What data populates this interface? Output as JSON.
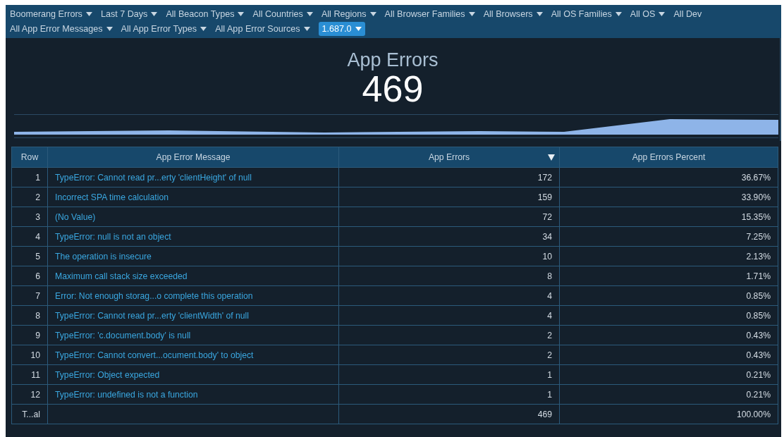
{
  "filter_lines": [
    [
      {
        "label": "Boomerang Errors",
        "selected": false
      },
      {
        "label": "Last 7 Days",
        "selected": false
      },
      {
        "label": "All Beacon Types",
        "selected": false
      },
      {
        "label": "All Countries",
        "selected": false
      },
      {
        "label": "All Regions",
        "selected": false
      },
      {
        "label": "All Browser Families",
        "selected": false
      },
      {
        "label": "All Browsers",
        "selected": false
      },
      {
        "label": "All OS Families",
        "selected": false
      },
      {
        "label": "All OS",
        "selected": false
      },
      {
        "label": "All Dev",
        "selected": false
      }
    ],
    [
      {
        "label": "All App Error Messages",
        "selected": false
      },
      {
        "label": "All App Error Types",
        "selected": false
      },
      {
        "label": "All App Error Sources",
        "selected": false
      },
      {
        "label": "1.687.0",
        "selected": true
      }
    ]
  ],
  "kpi": {
    "title": "App Errors",
    "value": "469"
  },
  "table": {
    "columns": [
      {
        "label": "Row",
        "sorted": false
      },
      {
        "label": "App Error Message",
        "sorted": false
      },
      {
        "label": "App Errors",
        "sorted": true
      },
      {
        "label": "App Errors Percent",
        "sorted": false
      }
    ],
    "rows": [
      {
        "kind": "data",
        "cells": [
          "1",
          "TypeError: Cannot read pr...erty 'clientHeight' of null",
          "172",
          "36.67%"
        ]
      },
      {
        "kind": "data",
        "cells": [
          "2",
          "Incorrect SPA time calculation",
          "159",
          "33.90%"
        ]
      },
      {
        "kind": "data",
        "cells": [
          "3",
          "(No Value)",
          "72",
          "15.35%"
        ]
      },
      {
        "kind": "data",
        "cells": [
          "4",
          "TypeError: null is not an object",
          "34",
          "7.25%"
        ]
      },
      {
        "kind": "data",
        "cells": [
          "5",
          "The operation is insecure",
          "10",
          "2.13%"
        ]
      },
      {
        "kind": "data",
        "cells": [
          "6",
          "Maximum call stack size exceeded",
          "8",
          "1.71%"
        ]
      },
      {
        "kind": "data",
        "cells": [
          "7",
          "Error: Not enough storag...o complete this operation",
          "4",
          "0.85%"
        ]
      },
      {
        "kind": "data",
        "cells": [
          "8",
          "TypeError: Cannot read pr...erty 'clientWidth' of null",
          "4",
          "0.85%"
        ]
      },
      {
        "kind": "data",
        "cells": [
          "9",
          "TypeError: 'c.document.body' is null",
          "2",
          "0.43%"
        ]
      },
      {
        "kind": "data",
        "cells": [
          "10",
          "TypeError: Cannot convert...ocument.body' to object",
          "2",
          "0.43%"
        ]
      },
      {
        "kind": "data",
        "cells": [
          "11",
          "TypeError: Object expected",
          "1",
          "0.21%"
        ]
      },
      {
        "kind": "data",
        "cells": [
          "12",
          "TypeError: undefined is not a function",
          "1",
          "0.21%"
        ]
      },
      {
        "kind": "total",
        "cells": [
          "T...al",
          "",
          "469",
          "100.00%"
        ]
      }
    ]
  }
}
